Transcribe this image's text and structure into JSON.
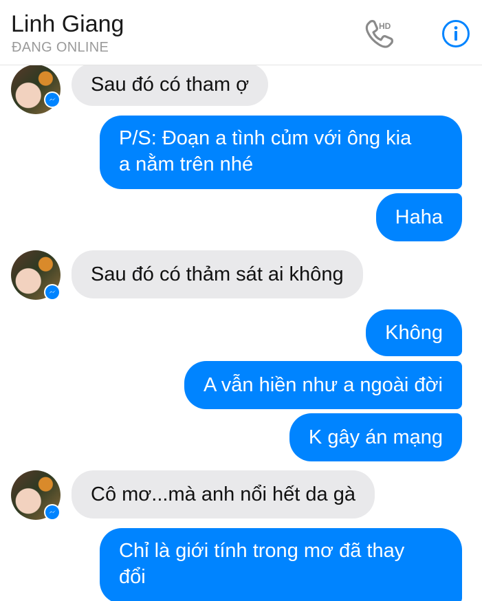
{
  "header": {
    "contact_name": "Linh Giang",
    "status": "ĐANG ONLINE",
    "call_badge": "HD",
    "call_icon": "phone-hd-icon",
    "info_icon": "info-icon",
    "accent_color": "#0084ff"
  },
  "messages": [
    {
      "direction": "incoming",
      "text": "Sau đó có tham ợ"
    },
    {
      "direction": "outgoing",
      "text": "P/S: Đoạn a tình củm với ông kia\na nằm trên nhé"
    },
    {
      "direction": "outgoing",
      "text": "Haha"
    },
    {
      "direction": "incoming",
      "text": "Sau đó có thảm sát ai không"
    },
    {
      "direction": "outgoing",
      "text": "Không"
    },
    {
      "direction": "outgoing",
      "text": "A vẫn hiền như a ngoài đời"
    },
    {
      "direction": "outgoing",
      "text": "K gây án mạng"
    },
    {
      "direction": "incoming",
      "text": "Cô mơ...mà anh nổi hết da gà"
    },
    {
      "direction": "outgoing",
      "text": "Chỉ là giới tính trong mơ đã thay\nđổi"
    }
  ],
  "colors": {
    "outgoing_bubble": "#0084ff",
    "incoming_bubble": "#e9e9eb"
  }
}
